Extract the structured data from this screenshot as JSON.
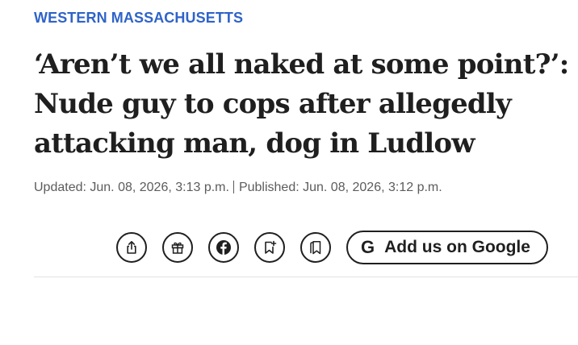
{
  "article": {
    "section": "WESTERN MASSACHUSETTS",
    "headline": "‘Aren’t we all naked at some point?’: Nude guy to cops after allegedly attacking man, dog in Ludlow",
    "updated": "Updated: Jun. 08, 2026, 3:13 p.m.",
    "published": "Published: Jun. 08, 2026, 3:12 p.m."
  },
  "toolbar": {
    "buttons": [
      {
        "icon": "share-icon"
      },
      {
        "icon": "gift-icon"
      },
      {
        "icon": "facebook-icon"
      },
      {
        "icon": "bookmark-add-icon"
      },
      {
        "icon": "saved-bookmarks-icon"
      }
    ],
    "google_icon": "G",
    "google_label": "Add us on Google"
  },
  "colors": {
    "section": "#2f63c8",
    "text": "#1f1f1f",
    "meta": "#5c5c5c",
    "divider": "#e2e2e2"
  }
}
